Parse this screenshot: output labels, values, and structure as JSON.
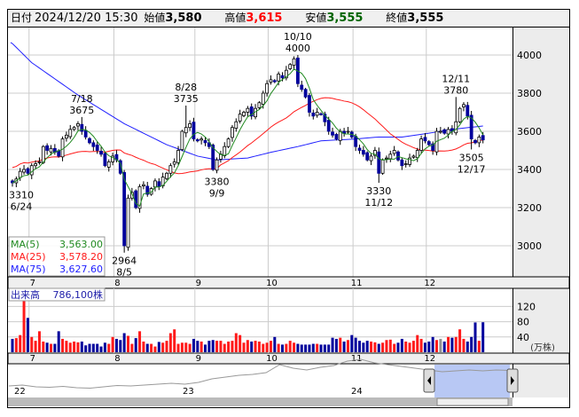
{
  "header": {
    "date_label": "日付",
    "datetime": "2024/12/20 15:30",
    "open_label": "始値",
    "open": "3,580",
    "high_label": "高値",
    "high": "3,615",
    "low_label": "安値",
    "low": "3,555",
    "close_label": "終値",
    "close": "3,555"
  },
  "colors": {
    "up": "#ffffff",
    "down": "#00009c",
    "ma5": "#208a20",
    "ma25": "#ff1a1a",
    "ma75": "#2020ff",
    "high": "#ff0000",
    "low": "#006400",
    "vol_up": "#ff1a1a",
    "vol_down": "#00009c",
    "vol_flat": "#909090"
  },
  "legend": {
    "ma5_label": "MA(5)",
    "ma5_value": "3,563.00",
    "ma25_label": "MA(25)",
    "ma25_value": "3,578.20",
    "ma75_label": "MA(75)",
    "ma75_value": "3,627.60"
  },
  "volume_label": {
    "title": "出来高",
    "value": "786,100株",
    "unit": "(万株)"
  },
  "price_axis": [
    "4000",
    "3800",
    "3600",
    "3400",
    "3200",
    "3000"
  ],
  "volume_axis": [
    "120",
    "80",
    "40"
  ],
  "months": [
    {
      "label": "7",
      "idx": 5
    },
    {
      "label": "8",
      "idx": 27
    },
    {
      "label": "9",
      "idx": 48
    },
    {
      "label": "10",
      "idx": 67
    },
    {
      "label": "11",
      "idx": 89
    },
    {
      "label": "12",
      "idx": 108
    }
  ],
  "annotations": [
    {
      "idx": 0,
      "price": 3310,
      "pos": "below",
      "l1": "3310",
      "l2": "6/24"
    },
    {
      "idx": 18,
      "price": 3675,
      "pos": "above",
      "l1": "7/18",
      "l2": "3675"
    },
    {
      "idx": 29,
      "price": 2964,
      "pos": "below",
      "l1": "2964",
      "l2": "8/5"
    },
    {
      "idx": 45,
      "price": 3735,
      "pos": "above",
      "l1": "8/28",
      "l2": "3735"
    },
    {
      "idx": 53,
      "price": 3380,
      "pos": "below",
      "l1": "3380",
      "l2": "9/9"
    },
    {
      "idx": 74,
      "price": 4000,
      "pos": "above",
      "l1": "10/10",
      "l2": "4000"
    },
    {
      "idx": 95,
      "price": 3330,
      "pos": "below",
      "l1": "3330",
      "l2": "11/12"
    },
    {
      "idx": 115,
      "price": 3780,
      "pos": "above",
      "l1": "12/11",
      "l2": "3780"
    },
    {
      "idx": 119,
      "price": 3505,
      "pos": "below",
      "l1": "3505",
      "l2": "12/17"
    }
  ],
  "closes": [
    3330,
    3350,
    3390,
    3400,
    3380,
    3420,
    3430,
    3440,
    3520,
    3500,
    3510,
    3490,
    3470,
    3560,
    3580,
    3610,
    3620,
    3640,
    3600,
    3570,
    3540,
    3520,
    3500,
    3480,
    3420,
    3440,
    3470,
    3450,
    3380,
    3000,
    3250,
    3280,
    3200,
    3310,
    3320,
    3270,
    3300,
    3340,
    3310,
    3360,
    3380,
    3420,
    3440,
    3500,
    3600,
    3620,
    3640,
    3560,
    3550,
    3560,
    3540,
    3520,
    3400,
    3450,
    3480,
    3520,
    3560,
    3620,
    3650,
    3690,
    3700,
    3720,
    3680,
    3720,
    3750,
    3800,
    3850,
    3870,
    3860,
    3900,
    3880,
    3920,
    3950,
    3980,
    3850,
    3820,
    3780,
    3700,
    3680,
    3700,
    3690,
    3650,
    3600,
    3580,
    3560,
    3600,
    3590,
    3600,
    3570,
    3520,
    3500,
    3480,
    3450,
    3470,
    3500,
    3380,
    3450,
    3460,
    3480,
    3500,
    3450,
    3420,
    3430,
    3460,
    3470,
    3500,
    3560,
    3550,
    3530,
    3500,
    3600,
    3600,
    3590,
    3610,
    3600,
    3650,
    3720,
    3740,
    3680,
    3560,
    3540,
    3570,
    3555
  ],
  "volumes": [
    35,
    37,
    45,
    140,
    90,
    40,
    30,
    55,
    28,
    25,
    22,
    22,
    55,
    35,
    30,
    25,
    28,
    26,
    28,
    18,
    22,
    22,
    22,
    15,
    25,
    22,
    40,
    35,
    32,
    50,
    43,
    22,
    37,
    55,
    28,
    22,
    22,
    15,
    27,
    25,
    30,
    50,
    60,
    22,
    25,
    25,
    22,
    35,
    30,
    28,
    20,
    30,
    32,
    30,
    30,
    22,
    28,
    30,
    50,
    45,
    25,
    32,
    28,
    30,
    28,
    22,
    25,
    30,
    40,
    22,
    20,
    22,
    30,
    25,
    22,
    20,
    20,
    20,
    22,
    22,
    20,
    20,
    20,
    38,
    35,
    38,
    28,
    32,
    45,
    38,
    30,
    25,
    30,
    28,
    26,
    22,
    25,
    32,
    33,
    22,
    25,
    35,
    28,
    25,
    30,
    45,
    35,
    25,
    28,
    40,
    32,
    35,
    28,
    40,
    38,
    40,
    60,
    35,
    28,
    40,
    78,
    30,
    78.6
  ],
  "ma75_points": [
    [
      0,
      4060
    ],
    [
      5,
      3960
    ],
    [
      17,
      3790
    ],
    [
      29,
      3640
    ],
    [
      40,
      3530
    ],
    [
      48,
      3470
    ],
    [
      53,
      3450
    ],
    [
      61,
      3460
    ],
    [
      67,
      3490
    ],
    [
      74,
      3520
    ],
    [
      80,
      3550
    ],
    [
      89,
      3560
    ],
    [
      95,
      3570
    ],
    [
      101,
      3570
    ],
    [
      108,
      3590
    ],
    [
      114,
      3610
    ],
    [
      122,
      3628
    ]
  ],
  "navigator": {
    "years": [
      "22",
      "23",
      "24"
    ],
    "series": [
      3000,
      3010,
      2990,
      2985,
      2995,
      2980,
      2975,
      2990,
      3005,
      3000,
      3010,
      3020,
      3030,
      3020,
      3040,
      3080,
      3100,
      3120,
      3130,
      3150,
      3240,
      3200,
      3180,
      3210,
      3230,
      3280,
      3300,
      3260,
      3240,
      3220,
      3200,
      3180,
      3160,
      3170,
      3180,
      3170,
      3180,
      3175
    ]
  }
}
